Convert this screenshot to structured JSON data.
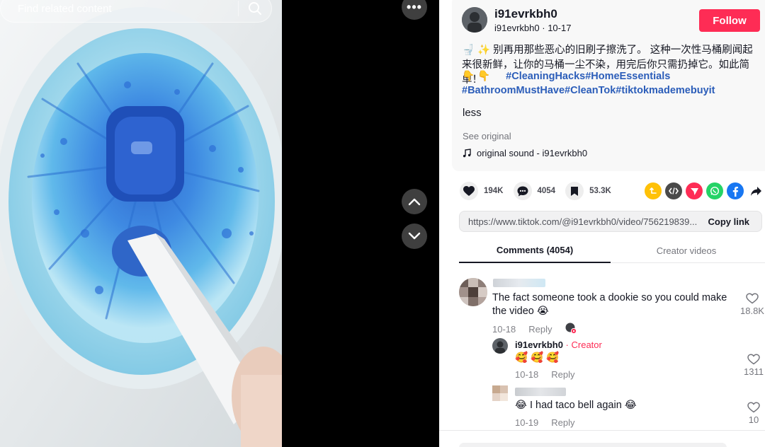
{
  "video": {
    "search_placeholder": "Find related content",
    "more_label": "•••"
  },
  "post": {
    "username": "i91evrkbh0",
    "handle": "i91evrkbh0",
    "date": "10-17",
    "follow_label": "Follow",
    "description": "🚽 ✨ 别再用那些恶心的旧刷子擦洗了。 这种一次性马桶刷闻起来很新鲜，让你的马桶一尘不染，用完后你只需扔掉它。如此简单！",
    "hashtag_emoji": "👇 👇",
    "hashtags": [
      "#CleaningHacks",
      "#HomeEssentials",
      "#BathroomMustHave",
      "#CleanTok",
      "#tiktokmademebuyit"
    ],
    "less_label": "less",
    "see_original": "See original",
    "sound": "original sound - i91evrkbh0"
  },
  "actions": {
    "likes": "194K",
    "comments": "4054",
    "saves": "53.3K"
  },
  "share_icons": [
    {
      "name": "repost-icon",
      "color": "#ffc107"
    },
    {
      "name": "embed-icon",
      "color": "#4a4a4a"
    },
    {
      "name": "send-icon",
      "color": "#fe2c55"
    },
    {
      "name": "whatsapp-icon",
      "color": "#25d366"
    },
    {
      "name": "facebook-icon",
      "color": "#1877f2"
    },
    {
      "name": "share-arrow-icon",
      "color": "#161823"
    }
  ],
  "link": {
    "url": "https://www.tiktok.com/@i91evrkbh0/video/756219839...",
    "copy_label": "Copy link"
  },
  "tabs": [
    {
      "label": "Comments (4054)"
    },
    {
      "label": "Creator videos"
    }
  ],
  "comments": [
    {
      "text_line1": "The fact someone took a dookie so you could make",
      "text_line2": "the video 😭",
      "date": "10-18",
      "reply_label": "Reply",
      "likes": "18.8K"
    },
    {
      "author": "i91evrkbh0",
      "creator_label": " · Creator",
      "text": "🥰 🥰 🥰",
      "date": "10-18",
      "reply_label": "Reply",
      "likes": "1311"
    },
    {
      "text": "😂 I had taco bell again 😂",
      "date": "10-19",
      "reply_label": "Reply",
      "likes": "10"
    }
  ]
}
